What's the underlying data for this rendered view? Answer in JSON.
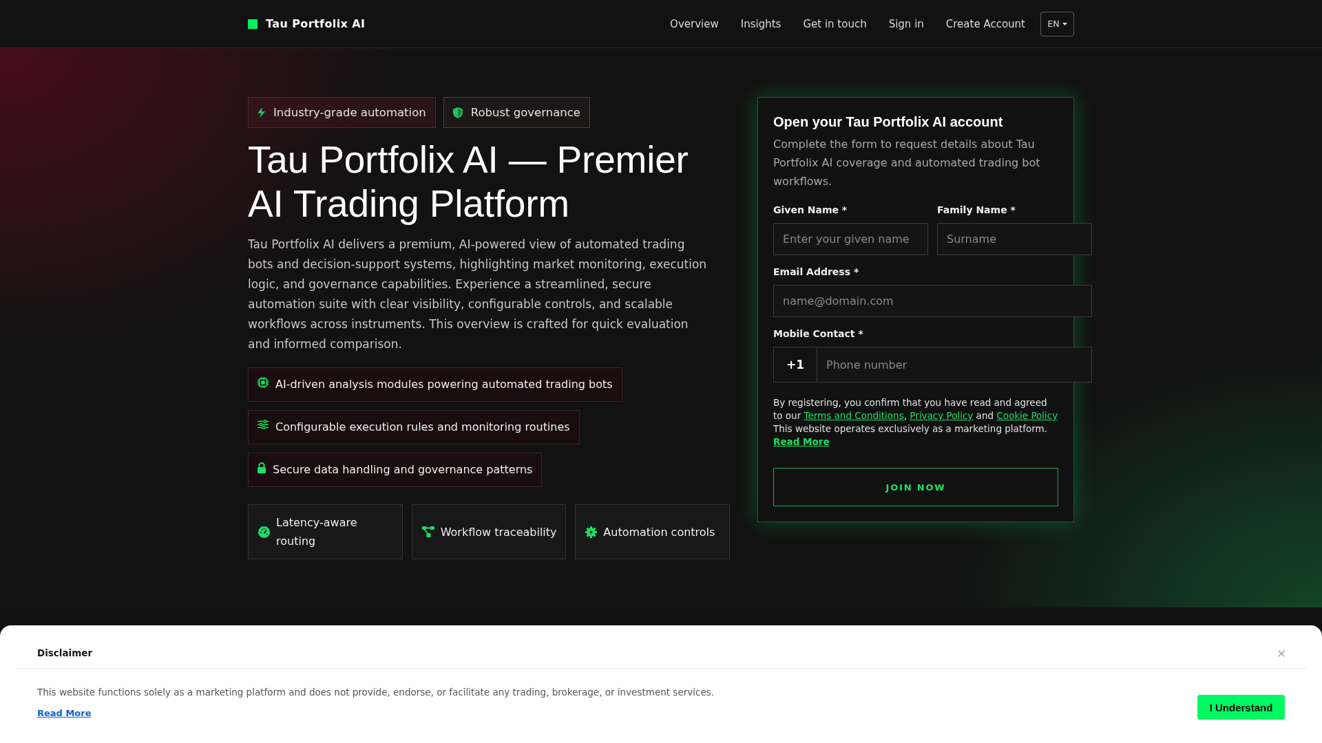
{
  "header": {
    "brand": "Tau Portfolix AI",
    "nav": [
      "Overview",
      "Insights",
      "Get in touch",
      "Sign in",
      "Create Account"
    ],
    "language": "EN"
  },
  "hero": {
    "tags": [
      "Industry-grade automation",
      "Robust governance"
    ],
    "title": "Tau Portfolix AI — Premier AI Trading Platform",
    "description": "Tau Portfolix AI delivers a premium, AI-powered view of automated trading bots and decision-support systems, highlighting market monitoring, execution logic, and governance capabilities. Experience a streamlined, secure automation suite with clear visibility, configurable controls, and scalable workflows across instruments. This overview is crafted for quick evaluation and informed comparison.",
    "features": [
      "AI-driven analysis modules powering automated trading bots",
      "Configurable execution rules and monitoring routines",
      "Secure data handling and governance patterns"
    ],
    "cards": [
      "Latency-aware routing",
      "Workflow traceability",
      "Automation controls"
    ]
  },
  "signup": {
    "title": "Open your Tau Portfolix AI account",
    "description": "Complete the form to request details about Tau Portfolix AI coverage and automated trading bot workflows.",
    "fields": [
      {
        "kind": "half",
        "label": "Given Name *",
        "placeholder": "Enter your given name"
      },
      {
        "kind": "half",
        "label": "Family Name *",
        "placeholder": "Surname"
      },
      {
        "kind": "full",
        "label": "Email Address *",
        "placeholder": "name@domain.com"
      },
      {
        "kind": "phone",
        "label": "Mobile Contact *",
        "prefix": "+1",
        "placeholder": "Phone number"
      }
    ],
    "consent": [
      {
        "kind": "text",
        "text": "By registering, you confirm that you have read and agreed to our "
      },
      {
        "kind": "link",
        "text": "Terms and Conditions"
      },
      {
        "kind": "text",
        "text": ", "
      },
      {
        "kind": "link",
        "text": "Privacy Policy"
      },
      {
        "kind": "text",
        "text": " and "
      },
      {
        "kind": "link",
        "text": "Cookie Policy"
      },
      {
        "kind": "text",
        "text": " This website operates exclusively as a marketing platform. "
      },
      {
        "kind": "strong_link",
        "text": "Read More"
      }
    ],
    "submit": "JOIN NOW"
  },
  "disclaimer": {
    "title": "Disclaimer",
    "text": "This website functions solely as a marketing platform and does not provide, endorse, or facilitate any trading, brokerage, or investment services.",
    "link": "Read More",
    "button": "I Understand"
  }
}
